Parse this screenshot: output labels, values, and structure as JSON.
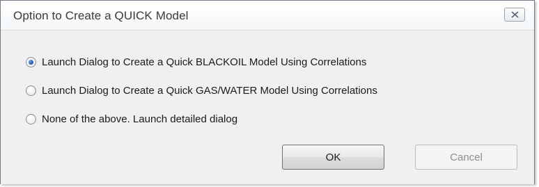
{
  "window": {
    "title": "Option to Create a QUICK Model",
    "close_icon": "close-x-icon"
  },
  "options": [
    {
      "label": "Launch Dialog to Create a Quick BLACKOIL Model Using Correlations",
      "selected": true
    },
    {
      "label": "Launch Dialog to Create a Quick GAS/WATER Model Using Correlations",
      "selected": false
    },
    {
      "label": "None of the above. Launch detailed dialog",
      "selected": false
    }
  ],
  "buttons": {
    "ok_label": "OK",
    "cancel_label": "Cancel",
    "cancel_enabled": false
  }
}
